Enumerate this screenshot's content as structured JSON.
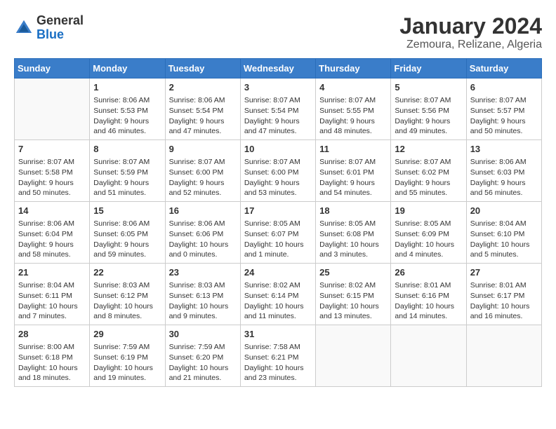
{
  "header": {
    "logo": {
      "general": "General",
      "blue": "Blue"
    },
    "title": "January 2024",
    "subtitle": "Zemoura, Relizane, Algeria"
  },
  "calendar": {
    "days": [
      "Sunday",
      "Monday",
      "Tuesday",
      "Wednesday",
      "Thursday",
      "Friday",
      "Saturday"
    ],
    "weeks": [
      {
        "shaded": false,
        "cells": [
          {
            "date": "",
            "sunrise": "",
            "sunset": "",
            "daylight": ""
          },
          {
            "date": "1",
            "sunrise": "Sunrise: 8:06 AM",
            "sunset": "Sunset: 5:53 PM",
            "daylight": "Daylight: 9 hours and 46 minutes."
          },
          {
            "date": "2",
            "sunrise": "Sunrise: 8:06 AM",
            "sunset": "Sunset: 5:54 PM",
            "daylight": "Daylight: 9 hours and 47 minutes."
          },
          {
            "date": "3",
            "sunrise": "Sunrise: 8:07 AM",
            "sunset": "Sunset: 5:54 PM",
            "daylight": "Daylight: 9 hours and 47 minutes."
          },
          {
            "date": "4",
            "sunrise": "Sunrise: 8:07 AM",
            "sunset": "Sunset: 5:55 PM",
            "daylight": "Daylight: 9 hours and 48 minutes."
          },
          {
            "date": "5",
            "sunrise": "Sunrise: 8:07 AM",
            "sunset": "Sunset: 5:56 PM",
            "daylight": "Daylight: 9 hours and 49 minutes."
          },
          {
            "date": "6",
            "sunrise": "Sunrise: 8:07 AM",
            "sunset": "Sunset: 5:57 PM",
            "daylight": "Daylight: 9 hours and 50 minutes."
          }
        ]
      },
      {
        "shaded": true,
        "cells": [
          {
            "date": "7",
            "sunrise": "Sunrise: 8:07 AM",
            "sunset": "Sunset: 5:58 PM",
            "daylight": "Daylight: 9 hours and 50 minutes."
          },
          {
            "date": "8",
            "sunrise": "Sunrise: 8:07 AM",
            "sunset": "Sunset: 5:59 PM",
            "daylight": "Daylight: 9 hours and 51 minutes."
          },
          {
            "date": "9",
            "sunrise": "Sunrise: 8:07 AM",
            "sunset": "Sunset: 6:00 PM",
            "daylight": "Daylight: 9 hours and 52 minutes."
          },
          {
            "date": "10",
            "sunrise": "Sunrise: 8:07 AM",
            "sunset": "Sunset: 6:00 PM",
            "daylight": "Daylight: 9 hours and 53 minutes."
          },
          {
            "date": "11",
            "sunrise": "Sunrise: 8:07 AM",
            "sunset": "Sunset: 6:01 PM",
            "daylight": "Daylight: 9 hours and 54 minutes."
          },
          {
            "date": "12",
            "sunrise": "Sunrise: 8:07 AM",
            "sunset": "Sunset: 6:02 PM",
            "daylight": "Daylight: 9 hours and 55 minutes."
          },
          {
            "date": "13",
            "sunrise": "Sunrise: 8:06 AM",
            "sunset": "Sunset: 6:03 PM",
            "daylight": "Daylight: 9 hours and 56 minutes."
          }
        ]
      },
      {
        "shaded": false,
        "cells": [
          {
            "date": "14",
            "sunrise": "Sunrise: 8:06 AM",
            "sunset": "Sunset: 6:04 PM",
            "daylight": "Daylight: 9 hours and 58 minutes."
          },
          {
            "date": "15",
            "sunrise": "Sunrise: 8:06 AM",
            "sunset": "Sunset: 6:05 PM",
            "daylight": "Daylight: 9 hours and 59 minutes."
          },
          {
            "date": "16",
            "sunrise": "Sunrise: 8:06 AM",
            "sunset": "Sunset: 6:06 PM",
            "daylight": "Daylight: 10 hours and 0 minutes."
          },
          {
            "date": "17",
            "sunrise": "Sunrise: 8:05 AM",
            "sunset": "Sunset: 6:07 PM",
            "daylight": "Daylight: 10 hours and 1 minute."
          },
          {
            "date": "18",
            "sunrise": "Sunrise: 8:05 AM",
            "sunset": "Sunset: 6:08 PM",
            "daylight": "Daylight: 10 hours and 3 minutes."
          },
          {
            "date": "19",
            "sunrise": "Sunrise: 8:05 AM",
            "sunset": "Sunset: 6:09 PM",
            "daylight": "Daylight: 10 hours and 4 minutes."
          },
          {
            "date": "20",
            "sunrise": "Sunrise: 8:04 AM",
            "sunset": "Sunset: 6:10 PM",
            "daylight": "Daylight: 10 hours and 5 minutes."
          }
        ]
      },
      {
        "shaded": true,
        "cells": [
          {
            "date": "21",
            "sunrise": "Sunrise: 8:04 AM",
            "sunset": "Sunset: 6:11 PM",
            "daylight": "Daylight: 10 hours and 7 minutes."
          },
          {
            "date": "22",
            "sunrise": "Sunrise: 8:03 AM",
            "sunset": "Sunset: 6:12 PM",
            "daylight": "Daylight: 10 hours and 8 minutes."
          },
          {
            "date": "23",
            "sunrise": "Sunrise: 8:03 AM",
            "sunset": "Sunset: 6:13 PM",
            "daylight": "Daylight: 10 hours and 9 minutes."
          },
          {
            "date": "24",
            "sunrise": "Sunrise: 8:02 AM",
            "sunset": "Sunset: 6:14 PM",
            "daylight": "Daylight: 10 hours and 11 minutes."
          },
          {
            "date": "25",
            "sunrise": "Sunrise: 8:02 AM",
            "sunset": "Sunset: 6:15 PM",
            "daylight": "Daylight: 10 hours and 13 minutes."
          },
          {
            "date": "26",
            "sunrise": "Sunrise: 8:01 AM",
            "sunset": "Sunset: 6:16 PM",
            "daylight": "Daylight: 10 hours and 14 minutes."
          },
          {
            "date": "27",
            "sunrise": "Sunrise: 8:01 AM",
            "sunset": "Sunset: 6:17 PM",
            "daylight": "Daylight: 10 hours and 16 minutes."
          }
        ]
      },
      {
        "shaded": false,
        "cells": [
          {
            "date": "28",
            "sunrise": "Sunrise: 8:00 AM",
            "sunset": "Sunset: 6:18 PM",
            "daylight": "Daylight: 10 hours and 18 minutes."
          },
          {
            "date": "29",
            "sunrise": "Sunrise: 7:59 AM",
            "sunset": "Sunset: 6:19 PM",
            "daylight": "Daylight: 10 hours and 19 minutes."
          },
          {
            "date": "30",
            "sunrise": "Sunrise: 7:59 AM",
            "sunset": "Sunset: 6:20 PM",
            "daylight": "Daylight: 10 hours and 21 minutes."
          },
          {
            "date": "31",
            "sunrise": "Sunrise: 7:58 AM",
            "sunset": "Sunset: 6:21 PM",
            "daylight": "Daylight: 10 hours and 23 minutes."
          },
          {
            "date": "",
            "sunrise": "",
            "sunset": "",
            "daylight": ""
          },
          {
            "date": "",
            "sunrise": "",
            "sunset": "",
            "daylight": ""
          },
          {
            "date": "",
            "sunrise": "",
            "sunset": "",
            "daylight": ""
          }
        ]
      }
    ]
  }
}
